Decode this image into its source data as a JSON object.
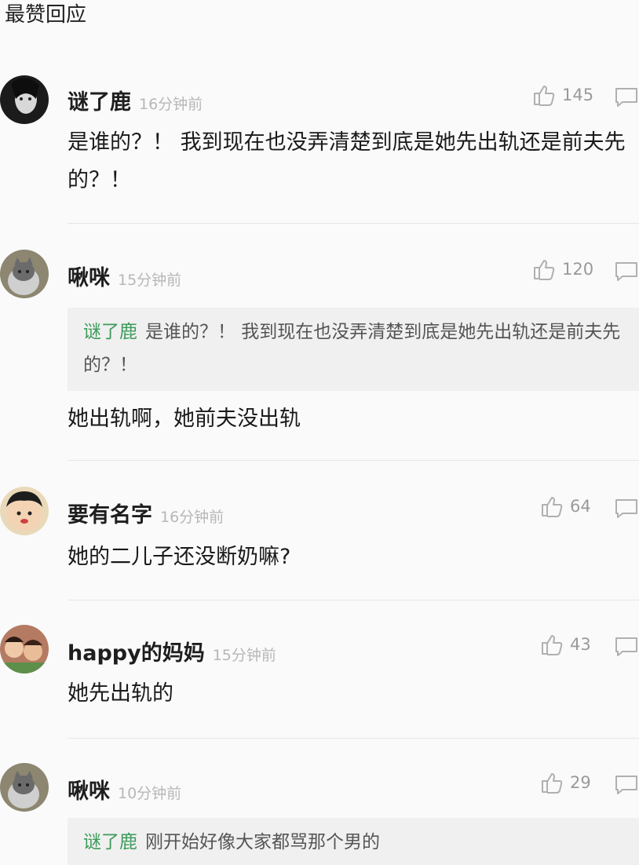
{
  "section_title": "最赞回应",
  "comments": [
    {
      "author": "谜了鹿",
      "time": "16分钟前",
      "likes": "145",
      "text": "是谁的？！ 我到现在也没弄清楚到底是她先出轨还是前夫先的？！"
    },
    {
      "author": "啾咪",
      "time": "15分钟前",
      "likes": "120",
      "quote_author": "谜了鹿",
      "quote_text": "是谁的？！ 我到现在也没弄清楚到底是她先出轨还是前夫先的？！",
      "text": "她出轨啊，她前夫没出轨"
    },
    {
      "author": "要有名字",
      "time": "16分钟前",
      "likes": "64",
      "text": "她的二儿子还没断奶嘛?"
    },
    {
      "author": "happy的妈妈",
      "time": "15分钟前",
      "likes": "43",
      "text": "她先出轨的"
    },
    {
      "author": "啾咪",
      "time": "10分钟前",
      "likes": "29",
      "quote_author": "谜了鹿",
      "quote_text": "刚开始好像大家都骂那个男的"
    }
  ]
}
